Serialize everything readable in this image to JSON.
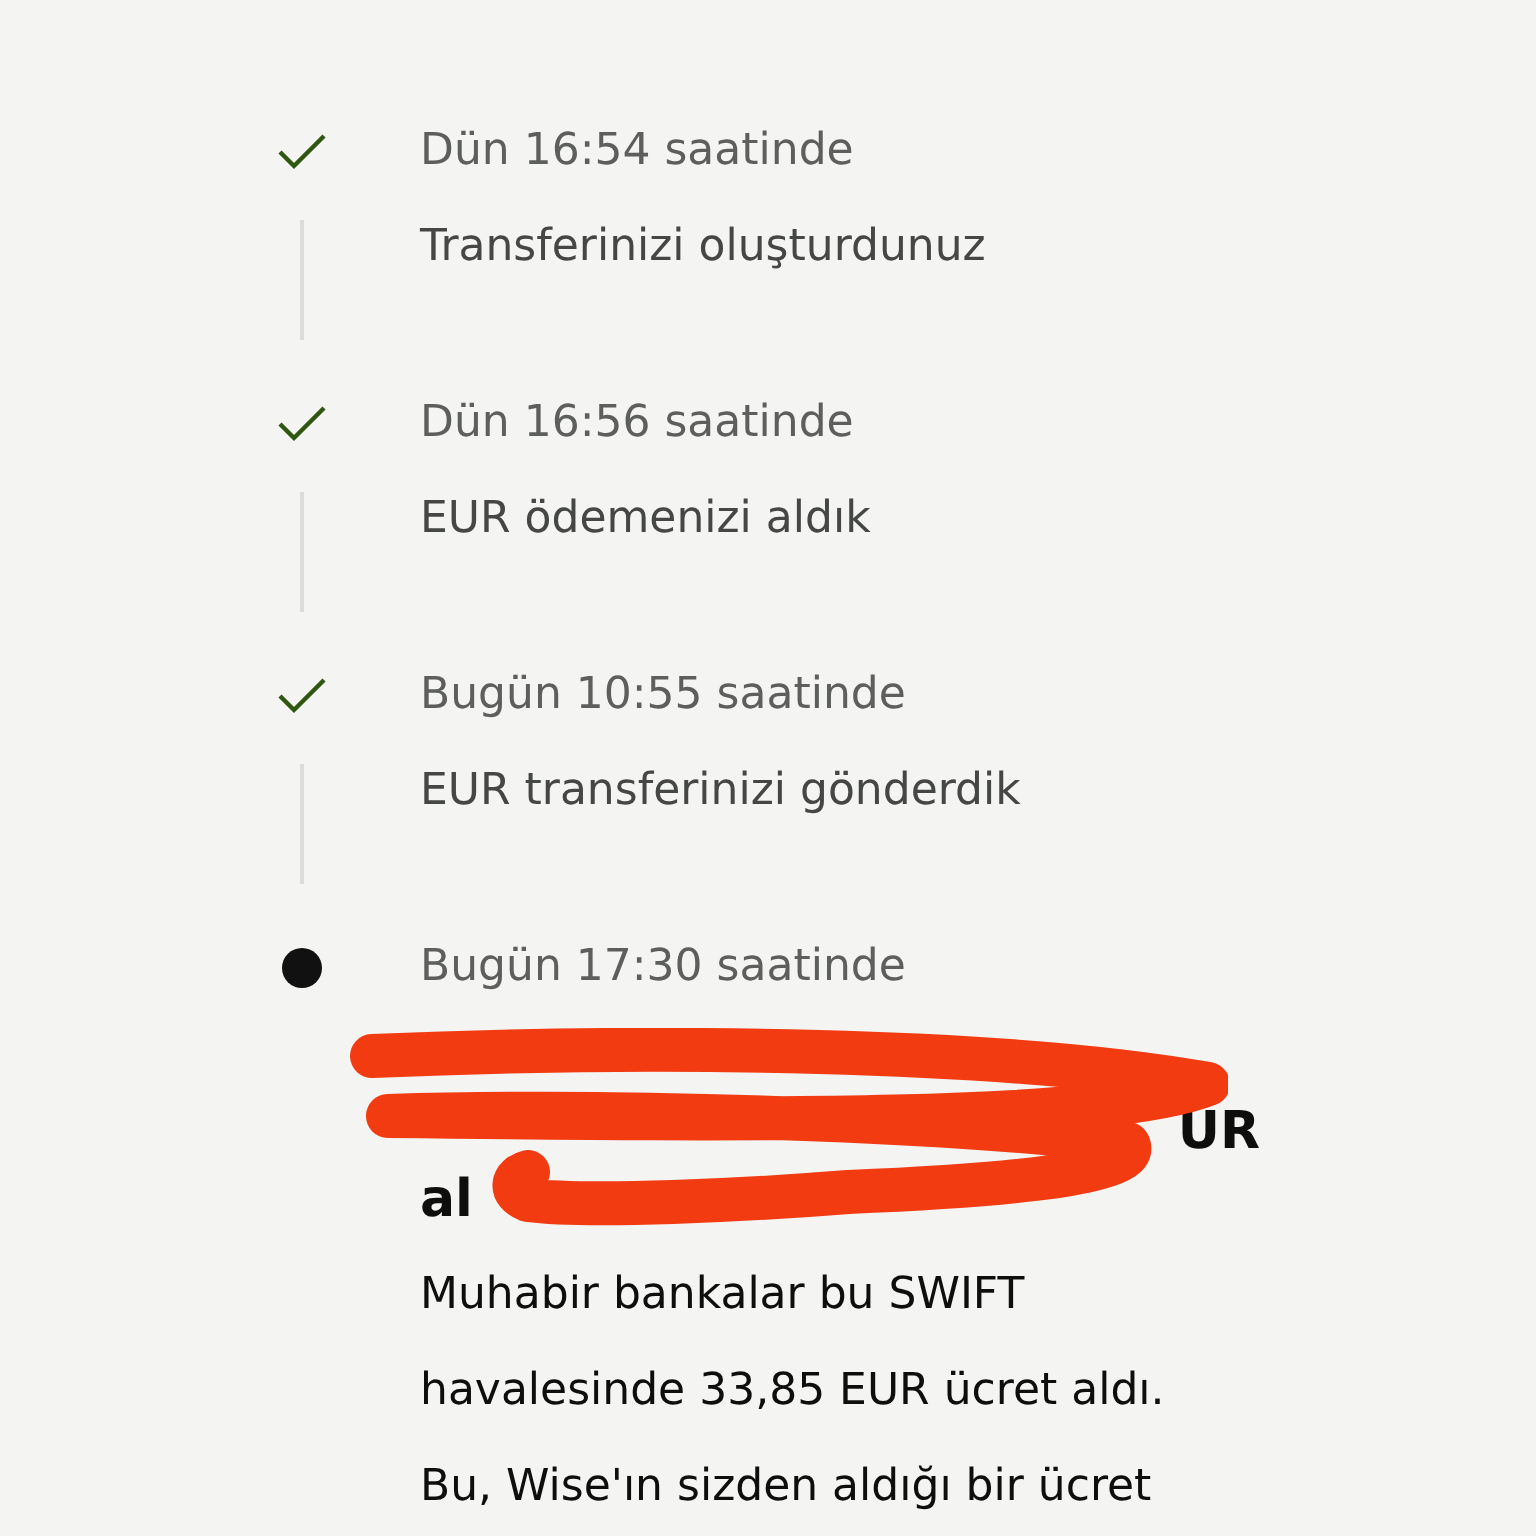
{
  "steps": [
    {
      "kind": "done",
      "time": "Dün 16:54 saatinde",
      "text": "Transferinizi oluşturdunuz"
    },
    {
      "kind": "done",
      "time": "Dün 16:56 saatinde",
      "text": "EUR ödemenizi aldık"
    },
    {
      "kind": "done",
      "time": "Bugün 10:55 saatinde",
      "text": "EUR transferinizi gönderdik"
    },
    {
      "kind": "current",
      "time": "Bugün 17:30 saatinde",
      "heading_fragments": [
        "UR",
        "al"
      ],
      "body_lines": [
        "Muhabir bankalar bu SWIFT",
        "havalesinde 33,85 EUR ücret aldı.",
        "Bu, Wise'ın sizden aldığı bir ücret"
      ]
    }
  ]
}
